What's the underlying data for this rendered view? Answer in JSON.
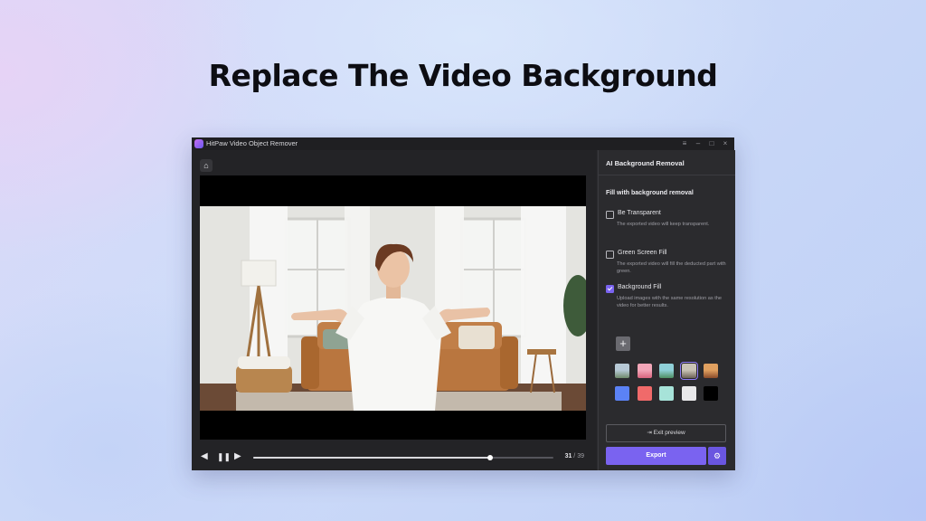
{
  "headline": "Replace The Video Background",
  "window": {
    "title": "HitPaw Video Object Remover",
    "controls": {
      "menu_icon": "≡",
      "minimize_icon": "–",
      "maximize_icon": "□",
      "close_icon": "×"
    }
  },
  "player": {
    "home_icon": "⌂",
    "prev_icon": "◀",
    "pause_icon": "❚❚",
    "next_icon": "▶",
    "current_frame": "31",
    "frame_separator": " / ",
    "total_frames": "39",
    "progress": 0.79
  },
  "panel": {
    "title": "AI Background Removal",
    "section_title": "Fill with background removal",
    "options": [
      {
        "label": "Be Transparent",
        "description": "The exported video will keep transparent.",
        "checked": false
      },
      {
        "label": "Green Screen Fill",
        "description": "The exported video will fill the deducted part with green.",
        "checked": false
      },
      {
        "label": "Background Fill",
        "description": "Upload images with the same resolution as the video for better results.",
        "checked": true
      }
    ],
    "add_icon": "+",
    "image_swatches": [
      {
        "name": "mountain-lake",
        "colors": [
          "#b7c9d6",
          "#6f8a6a"
        ]
      },
      {
        "name": "pink-sunset",
        "colors": [
          "#f2a6b8",
          "#d9647e"
        ]
      },
      {
        "name": "palm-beach",
        "colors": [
          "#8fd0d8",
          "#4e8e62"
        ]
      },
      {
        "name": "room-interior",
        "colors": [
          "#c9c3b6",
          "#6d6257"
        ],
        "selected": true
      },
      {
        "name": "autumn-scene",
        "colors": [
          "#e0a060",
          "#8a4b2a"
        ]
      }
    ],
    "color_swatches": [
      "#5b82f5",
      "#f06a6a",
      "#a7e3d9",
      "#e8e8ea",
      "#000000"
    ],
    "exit_preview_icon": "⇥",
    "exit_preview_label": "Exit preview",
    "export_label": "Export",
    "settings_icon": "⚙"
  }
}
